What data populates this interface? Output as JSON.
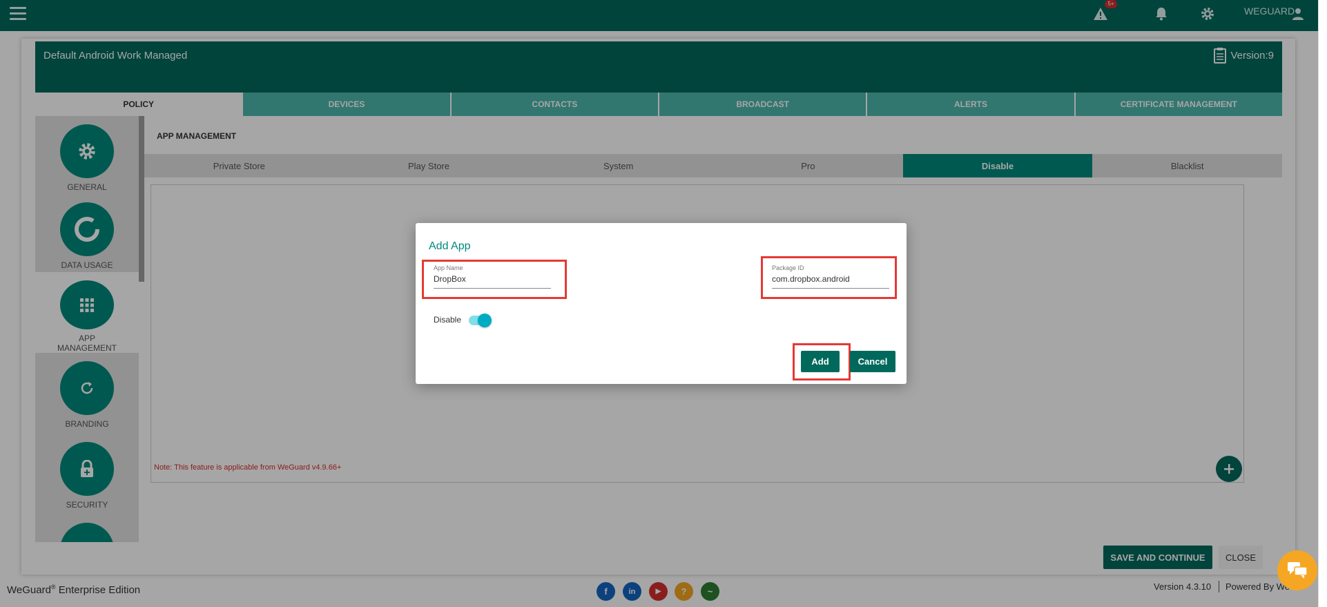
{
  "topbar": {
    "menu_icon": "hamburger-menu-icon",
    "alert_badge": "5+",
    "user_name": "WEGUARD",
    "icons": [
      "alert-icon",
      "bell-icon",
      "gear-icon",
      "user-icon"
    ]
  },
  "policy": {
    "title": "Default Android Work Managed",
    "version": "Version:9"
  },
  "main_tabs": [
    {
      "label": "POLICY",
      "active": true
    },
    {
      "label": "DEVICES",
      "active": false
    },
    {
      "label": "CONTACTS",
      "active": false
    },
    {
      "label": "BROADCAST",
      "active": false
    },
    {
      "label": "ALERTS",
      "active": false
    },
    {
      "label": "CERTIFICATE MANAGEMENT",
      "active": false
    }
  ],
  "sidebar": {
    "items": [
      {
        "label": "GENERAL",
        "icon": "gear-icon"
      },
      {
        "label": "DATA USAGE",
        "icon": "donut-chart-icon"
      },
      {
        "label": "APP\nMANAGEMENT",
        "icon": "app-grid-icon",
        "active": true
      },
      {
        "label": "BRANDING",
        "icon": "refresh-icon"
      },
      {
        "label": "SECURITY",
        "icon": "lock-icon"
      }
    ]
  },
  "app_management": {
    "section_title": "APP MANAGEMENT",
    "sub_tabs": [
      {
        "label": "Private Store",
        "active": false
      },
      {
        "label": "Play Store",
        "active": false
      },
      {
        "label": "System",
        "active": false
      },
      {
        "label": "Pro",
        "active": false
      },
      {
        "label": "Disable",
        "active": true
      },
      {
        "label": "Blacklist",
        "active": false
      }
    ],
    "note": "Note: This feature is applicable from WeGuard v4.9.66+"
  },
  "bottom_buttons": {
    "save": "SAVE AND CONTINUE",
    "close": "CLOSE"
  },
  "footer": {
    "brand": "WeGuard",
    "brand_sup": "®",
    "brand_suffix": " Enterprise Edition",
    "version": "Version 4.3.10",
    "powered_by": "Powered By We",
    "social": [
      {
        "icon": "facebook-icon",
        "glyph": "f",
        "color": "#1565c0"
      },
      {
        "icon": "linkedin-icon",
        "glyph": "in",
        "color": "#1565c0"
      },
      {
        "icon": "youtube-icon",
        "glyph": "▶",
        "color": "#d32f2f"
      },
      {
        "icon": "help-icon",
        "glyph": "?",
        "color": "#f5a623"
      },
      {
        "icon": "pulse-icon",
        "glyph": "~",
        "color": "#2e7d32"
      }
    ]
  },
  "dialog": {
    "title": "Add App",
    "app_name_label": "App Name",
    "app_name_value": "DropBox",
    "package_label": "Package ID",
    "package_value": "com.dropbox.android",
    "toggle_label": "Disable",
    "toggle_on": true,
    "add_button": "Add",
    "cancel_button": "Cancel"
  }
}
